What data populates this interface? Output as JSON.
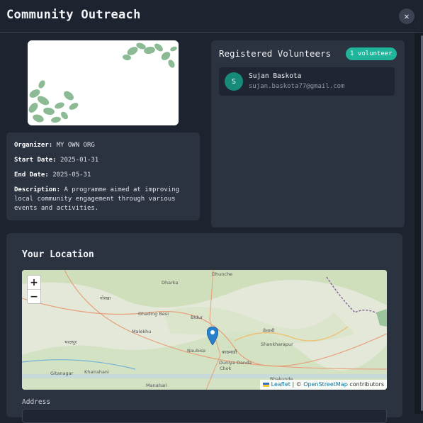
{
  "modal": {
    "title": "Community Outreach",
    "close_icon": "close-icon"
  },
  "event": {
    "organizer_label": "Organizer:",
    "organizer": "MY OWN ORG",
    "start_label": "Start Date:",
    "start_date": "2025-01-31",
    "end_label": "End Date:",
    "end_date": "2025-05-31",
    "description_label": "Description:",
    "description": "A programme aimed at improving local community engagement through various events and activities."
  },
  "volunteers": {
    "title": "Registered Volunteers",
    "count_badge": "1 volunteer",
    "items": [
      {
        "initial": "S",
        "name": "Sujan Baskota",
        "email": "sujan.baskota77@gmail.com"
      }
    ]
  },
  "location": {
    "title": "Your Location",
    "zoom_in": "+",
    "zoom_out": "−",
    "attribution_leaflet": "Leaflet",
    "attribution_sep": " | © ",
    "attribution_osm": "OpenStreetMap",
    "attribution_tail": " contributors",
    "labels": {
      "dhunche": "Dhunche",
      "dharka": "Dharka",
      "dhading": "Dhading Besi",
      "malekhu": "Malekhu",
      "bidur": "Bidur",
      "naubise": "Naubise",
      "shankharapur": "Shankharapur",
      "dunlya": "Duniya Danda",
      "chok": "Chok",
      "gitanagar": "Gitanagar",
      "khairahani": "Khairahani",
      "manahari": "Manahari",
      "bhakunde": "Bhakunde",
      "gorkha": "गोरखा",
      "kathmandu": "काठमाडौं",
      "bharatpur": "भरतपुर",
      "melamchi": "मेलम्ची"
    },
    "address_label": "Address"
  },
  "colors": {
    "accent": "#1fb59b",
    "background": "#1d2430",
    "card": "#2b3240",
    "marker": "#2a81cb"
  }
}
